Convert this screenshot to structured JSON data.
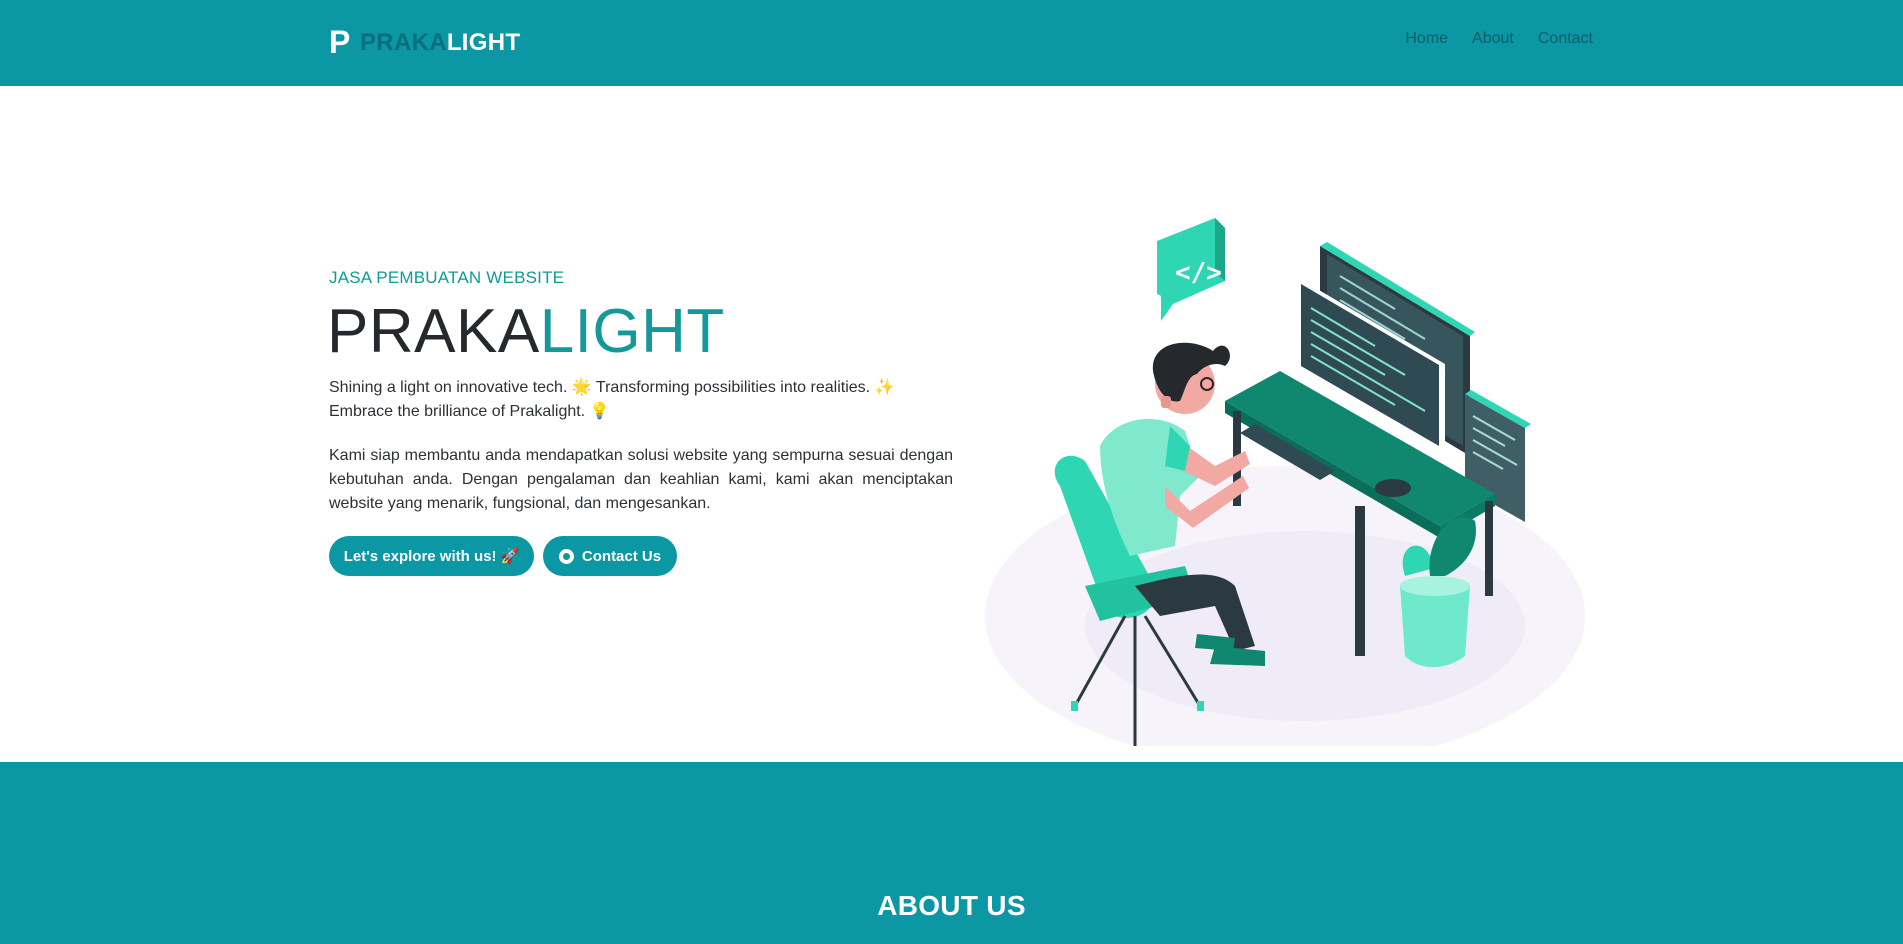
{
  "brand": {
    "mark": "P",
    "name_part1": "PRAKA",
    "name_part2": "LIGHT"
  },
  "nav": {
    "items": [
      "Home",
      "About",
      "Contact"
    ]
  },
  "hero": {
    "kicker": "JASA PEMBUATAN WEBSITE",
    "title_part1": "PRAKA",
    "title_part2": "LIGHT",
    "tagline_line1": "Shining a light on innovative tech. 🌟 Transforming possibilities into realities. ✨",
    "tagline_line2": "Embrace the brilliance of Prakalight. 💡",
    "description": "Kami siap membantu anda mendapatkan solusi website yang sempurna sesuai dengan kebutuhan anda. Dengan pengalaman dan keahlian kami, kami akan menciptakan website yang menarik, fungsional, dan mengesankan.",
    "explore_button": "Let's explore with us! 🚀",
    "contact_button": "Contact Us"
  },
  "about": {
    "title": "ABOUT US"
  },
  "colors": {
    "primary": "#0b97a3",
    "accent": "#13999a",
    "brand_dark": "#0a6f7d",
    "illustration_green": "#10876f",
    "illustration_mint": "#2ed6b3"
  },
  "icons": {
    "contact": "whatsapp-icon"
  }
}
